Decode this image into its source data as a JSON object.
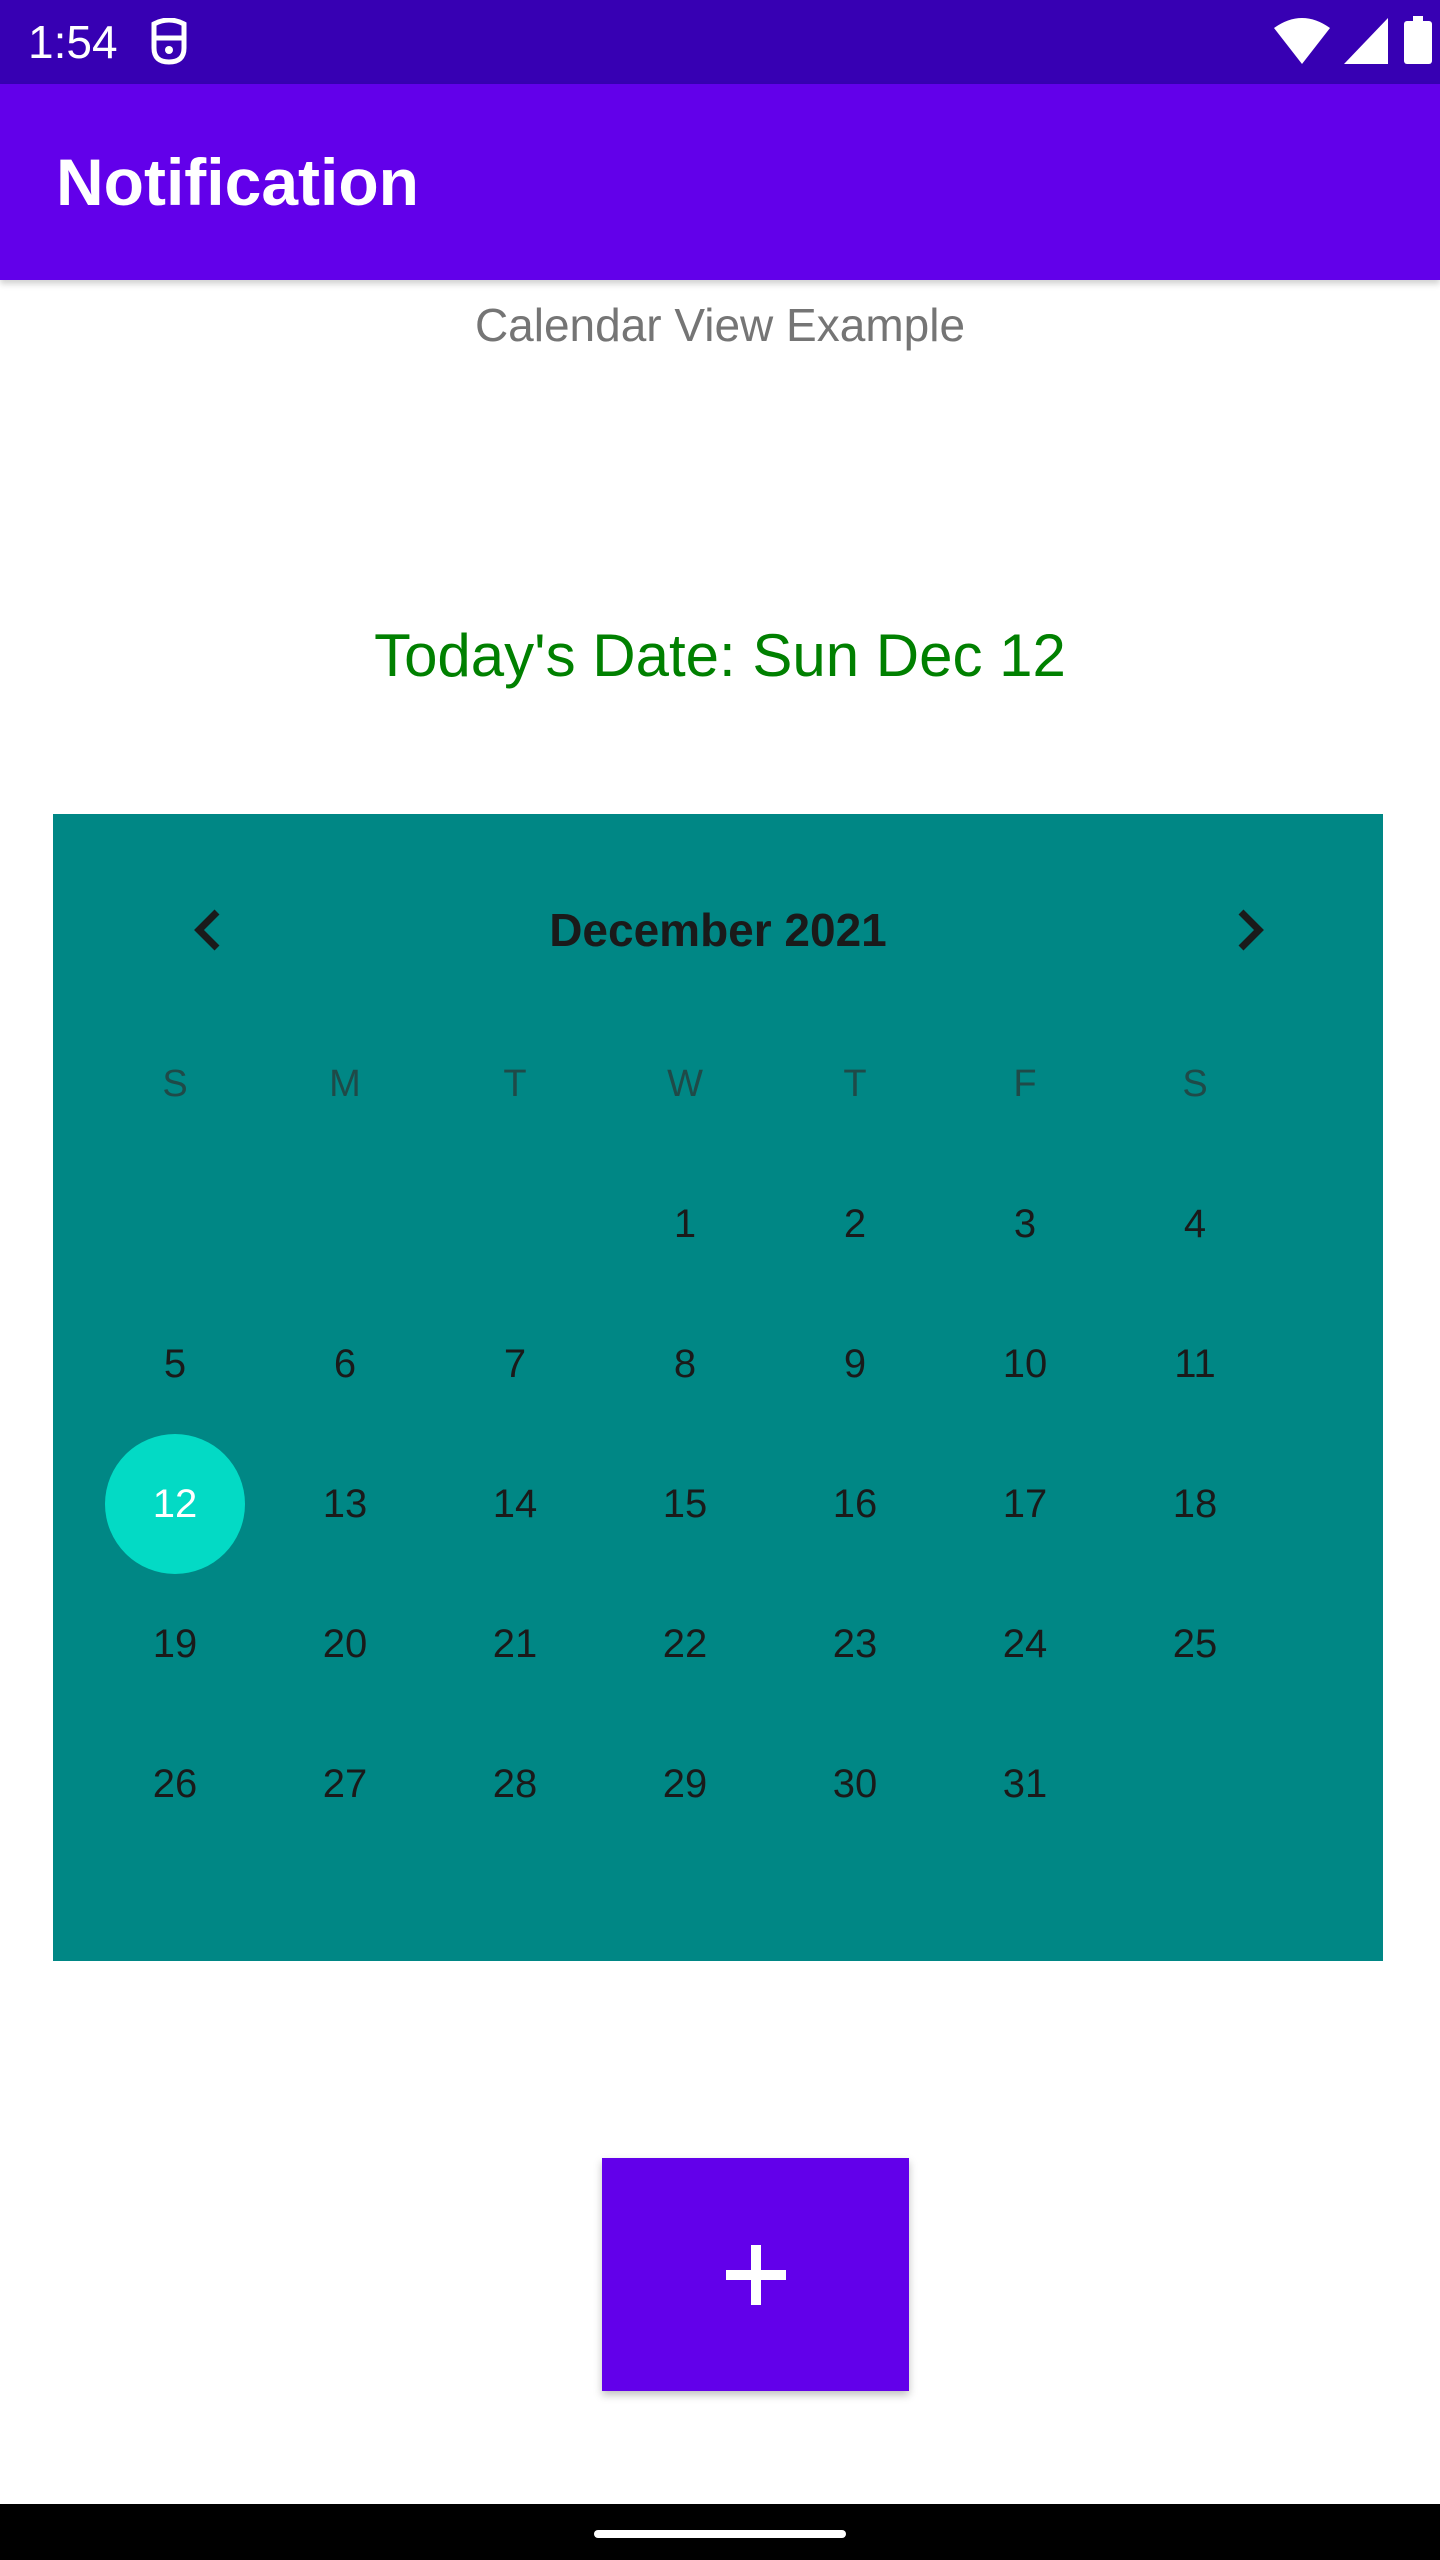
{
  "status_bar": {
    "time": "1:54",
    "icons": [
      "notification-icon",
      "wifi-icon",
      "signal-icon",
      "battery-icon"
    ]
  },
  "app_bar": {
    "title": "Notification",
    "color": "#6200ea"
  },
  "main": {
    "subtitle": "Calendar View Example",
    "today_label": "Today's Date: Sun Dec 12",
    "today_color": "#008000"
  },
  "calendar": {
    "month_label": "December 2021",
    "background": "#008785",
    "selected_color": "#03dac5",
    "prev_icon": "chevron-left-icon",
    "next_icon": "chevron-right-icon",
    "weekdays": [
      "S",
      "M",
      "T",
      "W",
      "T",
      "F",
      "S"
    ],
    "weeks": [
      [
        "",
        "",
        "",
        "1",
        "2",
        "3",
        "4"
      ],
      [
        "5",
        "6",
        "7",
        "8",
        "9",
        "10",
        "11"
      ],
      [
        "12",
        "13",
        "14",
        "15",
        "16",
        "17",
        "18"
      ],
      [
        "19",
        "20",
        "21",
        "22",
        "23",
        "24",
        "25"
      ],
      [
        "26",
        "27",
        "28",
        "29",
        "30",
        "31",
        ""
      ]
    ],
    "selected_day": "12"
  },
  "fab": {
    "icon": "plus-icon"
  }
}
